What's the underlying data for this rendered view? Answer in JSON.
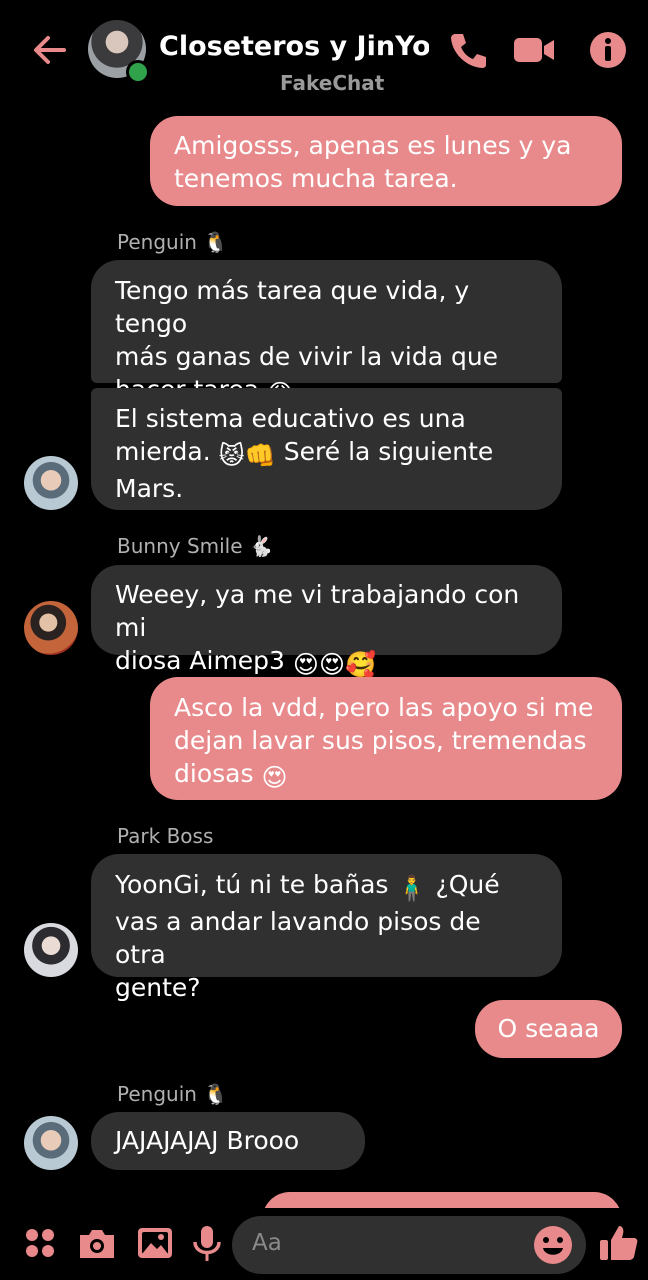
{
  "colors": {
    "accent": "#e88a8b",
    "incoming_bubble": "#303030",
    "background": "#000000",
    "online": "#31a24c"
  },
  "header": {
    "back_icon": "arrow-left-icon",
    "title": "Closeteros y JinYo...",
    "subtitle": "FakeChat",
    "call_icon": "phone-icon",
    "video_icon": "video-camera-icon",
    "info_icon": "info-icon"
  },
  "messages": [
    {
      "direction": "out",
      "text": "Amigosss, apenas es lunes y ya\ntenemos mucha tarea."
    },
    {
      "sender": "Penguin",
      "sender_emoji": "🐧"
    },
    {
      "direction": "in",
      "text": "Tengo más tarea que vida, y tengo\nmás ganas de vivir la vida que\nhacer tarea",
      "emoji": "😩"
    },
    {
      "direction": "in",
      "text_1": "El sistema educativo es una\nmierda. ",
      "emoji_1": "😾👊",
      "text_2": " Seré la siguiente\nMars."
    },
    {
      "sender": "Bunny Smile",
      "sender_emoji": "🐇"
    },
    {
      "direction": "in",
      "text": "Weeey, ya me vi trabajando con mi\ndiosa Aimep3 ",
      "emoji": "😍😍🥰"
    },
    {
      "direction": "out",
      "text": "Asco la vdd, pero las apoyo si me\ndejan lavar sus pisos, tremendas\ndiosas ",
      "emoji": "😍"
    },
    {
      "sender": "Park Boss"
    },
    {
      "direction": "in",
      "text_1": "YoonGi, tú ni te bañas ",
      "emoji_1": "🧍‍♂️",
      "text_2": " ¿Qué\nvas a andar lavando pisos de otra\ngente?"
    },
    {
      "direction": "out",
      "text": "O seaaa"
    },
    {
      "sender": "Penguin",
      "sender_emoji": "🐧"
    },
    {
      "direction": "in",
      "text": "JAJAJAJAJ Brooo"
    }
  ],
  "composer": {
    "placeholder": "Aa",
    "menu_icon": "four-dots-icon",
    "camera_icon": "camera-icon",
    "gallery_icon": "image-icon",
    "mic_icon": "microphone-icon",
    "emoji_icon": "smiley-icon",
    "like_icon": "thumbs-up-icon"
  }
}
